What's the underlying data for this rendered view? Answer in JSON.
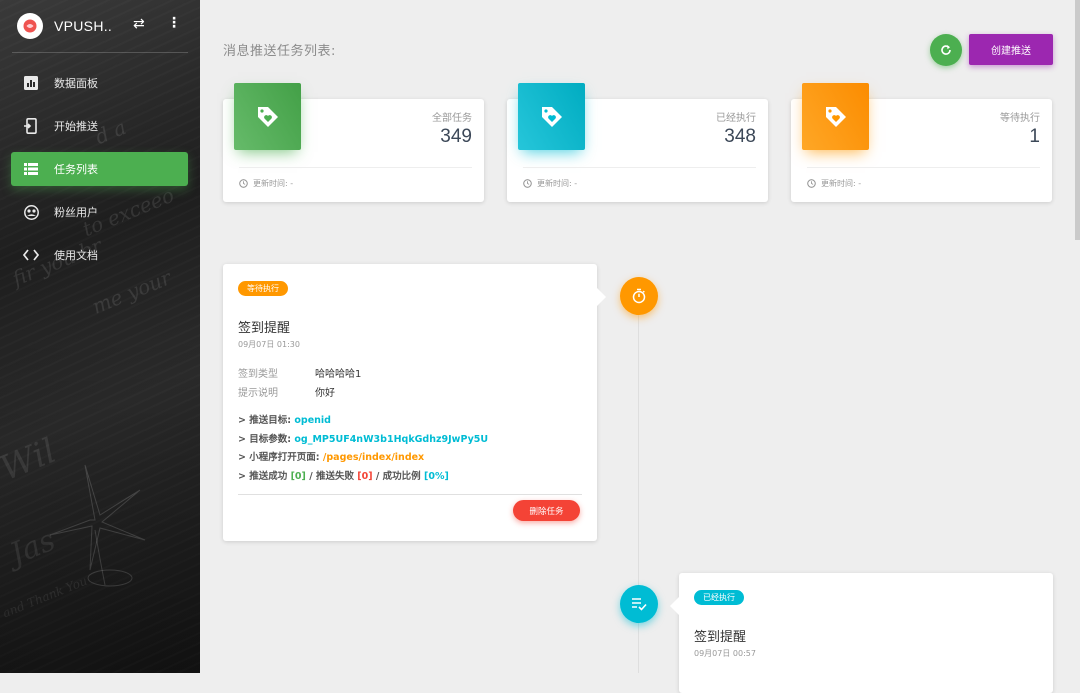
{
  "brand": {
    "name": "VPUSH..",
    "swap_icon": "swap-icon",
    "more_icon": "more-vert-icon"
  },
  "nav": [
    {
      "label": "数据面板",
      "icon": "bar-chart-icon",
      "active": false
    },
    {
      "label": "开始推送",
      "icon": "phone-push-icon",
      "active": false
    },
    {
      "label": "任务列表",
      "icon": "list-icon",
      "active": true
    },
    {
      "label": "粉丝用户",
      "icon": "users-icon",
      "active": false
    },
    {
      "label": "使用文档",
      "icon": "code-icon",
      "active": false
    }
  ],
  "header": {
    "title": "消息推送任务列表:",
    "create_label": "创建推送"
  },
  "stats": [
    {
      "label": "全部任务",
      "value": "349",
      "footer": "更新时间: -",
      "color": "#4caf50"
    },
    {
      "label": "已经执行",
      "value": "348",
      "footer": "更新时间: -",
      "color": "#00bcd4"
    },
    {
      "label": "等待执行",
      "value": "1",
      "footer": "更新时间: -",
      "color": "#ff9800"
    }
  ],
  "tasks": [
    {
      "status": "等待执行",
      "title": "签到提醒",
      "time": "09月07日 01:30",
      "meta": [
        {
          "key": "签到类型",
          "value": "哈哈哈哈1"
        },
        {
          "key": "提示说明",
          "value": "你好"
        }
      ],
      "target_label": "> 推送目标:",
      "target_value": "openid",
      "param_label": "> 目标参数:",
      "param_value": "og_MP5UF4nW3b1HqkGdhz9JwPy5U",
      "page_label": "> 小程序打开页面:",
      "page_value": "/pages/index/index",
      "success_label": "> 推送成功",
      "success_value": "[0]",
      "fail_label": "/ 推送失败",
      "fail_value": "[0]",
      "ratio_label": "/ 成功比例",
      "ratio_value": "[0%]",
      "delete_label": "删除任务"
    },
    {
      "status": "已经执行",
      "title": "签到提醒",
      "time": "09月07日 00:57"
    }
  ]
}
